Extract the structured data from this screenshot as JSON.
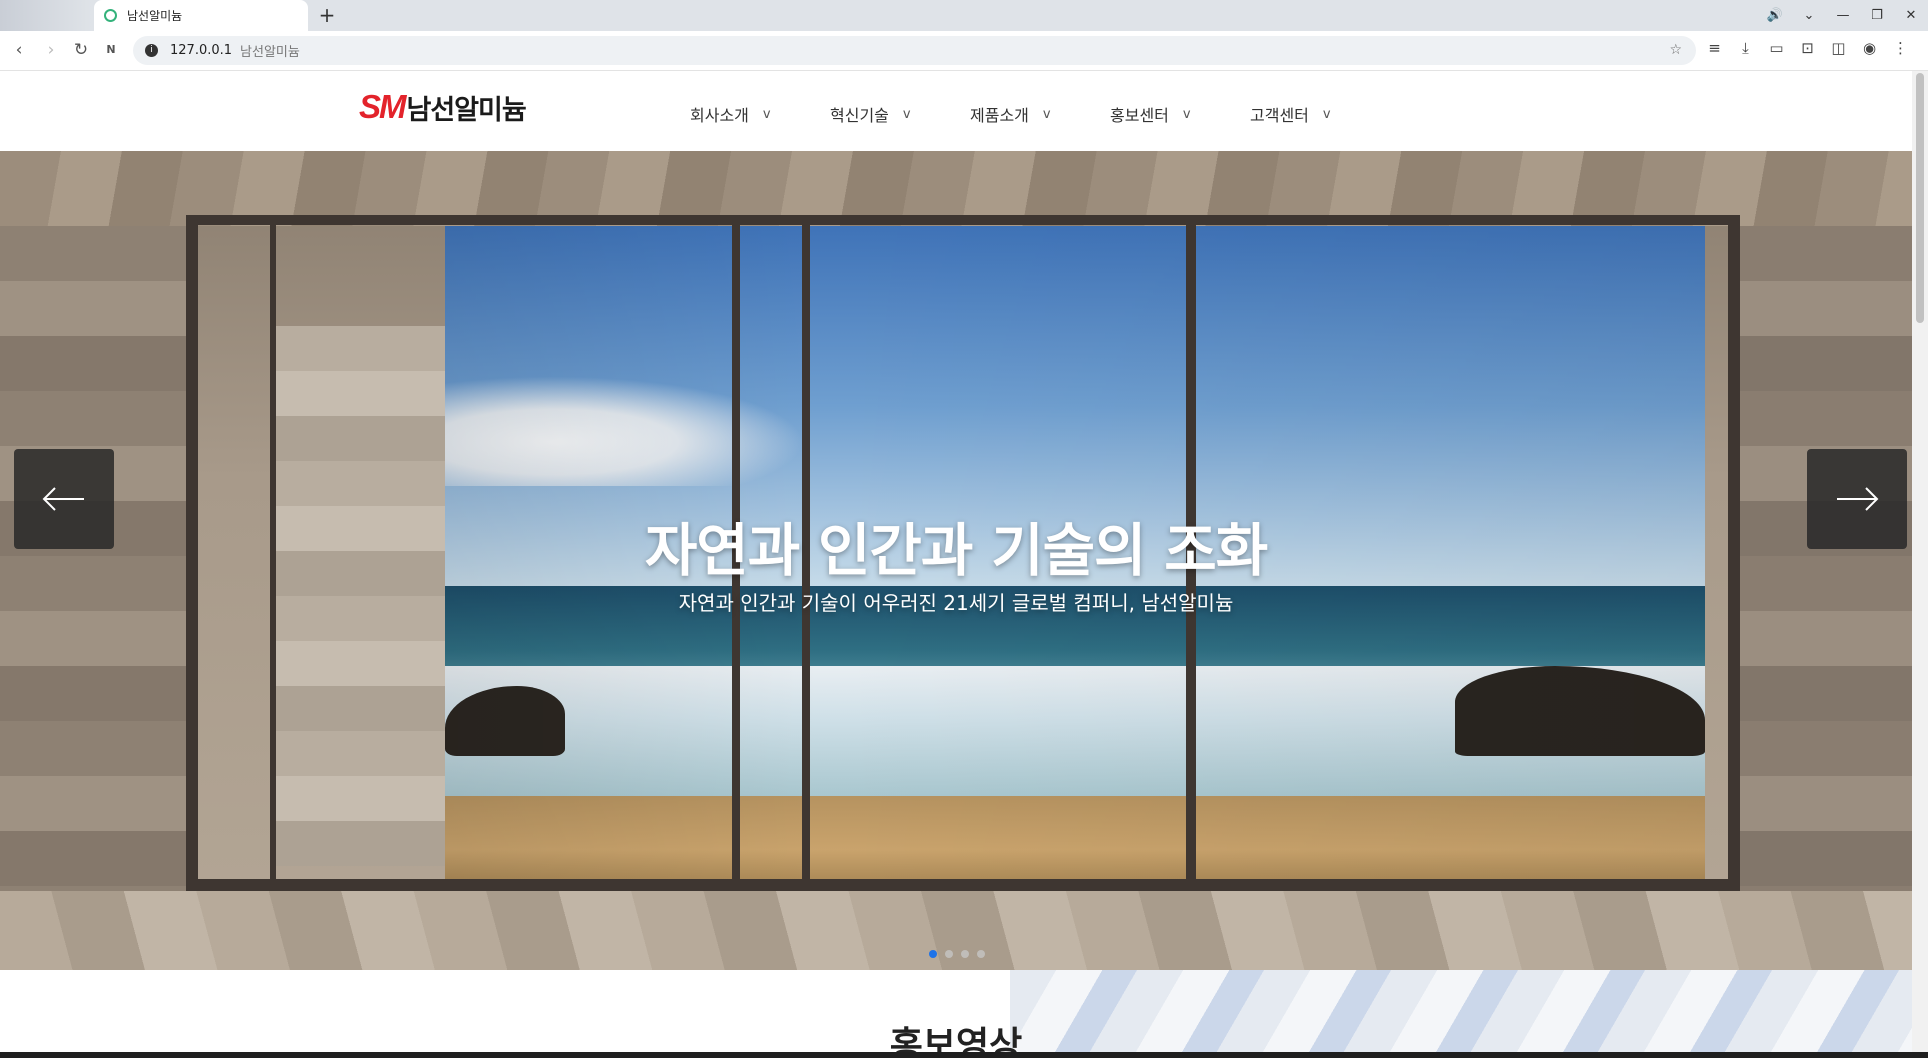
{
  "browser": {
    "tab_title": "남선알미늄",
    "new_tab_symbol": "+",
    "url": "127.0.0.1",
    "url_page_title": "남선알미늄",
    "window_controls": [
      "🔊",
      "⌄",
      "—",
      "❐",
      "✕"
    ],
    "nav_icons": [
      "back-icon",
      "forward-icon",
      "reload-icon",
      "naver-icon"
    ],
    "toolbar_icons": [
      "reading-list-icon",
      "download-icon",
      "cast-icon",
      "screenshot-icon",
      "sidebar-icon",
      "profile-icon",
      "more-icon"
    ]
  },
  "site": {
    "logo_mark": "SM",
    "logo_text": "남선알미늄",
    "brand_color": "#e3232b",
    "menu": [
      {
        "label": "회사소개",
        "caret": "v"
      },
      {
        "label": "혁신기술",
        "caret": "v"
      },
      {
        "label": "제품소개",
        "caret": "v"
      },
      {
        "label": "홍보센터",
        "caret": "v"
      },
      {
        "label": "고객센터",
        "caret": "v"
      }
    ]
  },
  "hero": {
    "title": "자연과 인간과 기술의 조화",
    "subtitle": "자연과 인간과 기술이 어우러진 21세기 글로벌 컴퍼니, 남선알미늄",
    "slide_count": 4,
    "active_slide": 1,
    "active_dot_color": "#1e73e8"
  },
  "section": {
    "title": "홍보영상"
  }
}
